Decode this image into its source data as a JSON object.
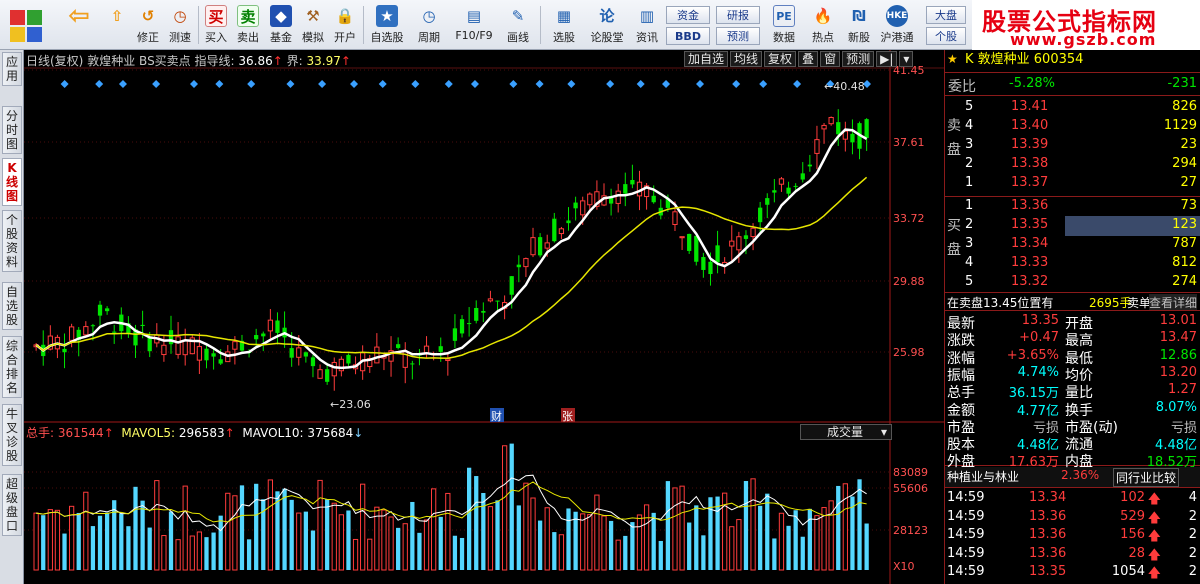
{
  "toolbar": {
    "buttons": [
      "修正",
      "测速",
      "买入",
      "卖出",
      "基金",
      "模拟",
      "开户",
      "自选股",
      "周期",
      "F10/F9",
      "画线",
      "选股",
      "论股堂",
      "资讯",
      "数据",
      "热点",
      "新股",
      "沪港通"
    ],
    "small": {
      "zijin": "资金",
      "bbd": "BBD",
      "yanbao": "研报",
      "yuce": "预测",
      "dapan": "大盘",
      "gegu": "个股"
    }
  },
  "brand": {
    "title": "股票公式指标网",
    "url": "www.gszb.com"
  },
  "side_tabs": [
    "应用",
    "分时图",
    "K线图",
    "个股资料",
    "自选股",
    "综合排名",
    "牛叉诊股",
    "超级盘口"
  ],
  "chart": {
    "header": {
      "period": "日线(复权)",
      "stock": "敦煌种业",
      "indicator": "BS买卖点",
      "guide_label": "指导线:",
      "guide_value": "36.86",
      "bound_label": "界:",
      "bound_value": "33.97"
    },
    "buttons": [
      "加自选",
      "均线",
      "复权",
      "叠",
      "窗",
      "预测"
    ],
    "price_axis": [
      "41.45",
      "37.61",
      "33.72",
      "29.88",
      "25.98"
    ],
    "annotations": {
      "high": "40.48",
      "low": "23.06"
    },
    "markers": {
      "cai": "财",
      "zhang": "张"
    },
    "volume_header": {
      "total_label": "总手:",
      "total_value": "361544",
      "ma5_label": "MAVOL5:",
      "ma5_value": "296583",
      "ma10_label": "MAVOL10:",
      "ma10_value": "375684"
    },
    "volume_select": "成交量",
    "volume_axis": [
      "83089",
      "55606",
      "28123",
      "X10"
    ],
    "colors": {
      "up": "#ff3c3c",
      "down": "#00e600",
      "ma_white": "#ffffff",
      "ma_yellow": "#e6e600",
      "vol_up": "#ff3c3c",
      "vol_down": "#54d7ff"
    }
  },
  "panel": {
    "title": "K 敦煌种业 600354",
    "weibi_label": "委比",
    "weibi_pct": "-5.28%",
    "weibi_val": "-231",
    "sell_label": "卖盘",
    "buy_label": "买盘",
    "sell": [
      {
        "lvl": "5",
        "price": "13.41",
        "vol": "826"
      },
      {
        "lvl": "4",
        "price": "13.40",
        "vol": "1129"
      },
      {
        "lvl": "3",
        "price": "13.39",
        "vol": "23"
      },
      {
        "lvl": "2",
        "price": "13.38",
        "vol": "294"
      },
      {
        "lvl": "1",
        "price": "13.37",
        "vol": "27"
      }
    ],
    "buy": [
      {
        "lvl": "1",
        "price": "13.36",
        "vol": "73"
      },
      {
        "lvl": "2",
        "price": "13.35",
        "vol": "123"
      },
      {
        "lvl": "3",
        "price": "13.34",
        "vol": "787"
      },
      {
        "lvl": "4",
        "price": "13.33",
        "vol": "812"
      },
      {
        "lvl": "5",
        "price": "13.32",
        "vol": "274"
      }
    ],
    "notice": {
      "left": "在卖盘13.45位置有",
      "qty": "2695手",
      "right": "卖单!",
      "link": "查看详细"
    },
    "stats": [
      {
        "l1": "最新",
        "v1": "13.35",
        "c1": "red",
        "l2": "开盘",
        "v2": "13.01",
        "c2": "red"
      },
      {
        "l1": "涨跌",
        "v1": "+0.47",
        "c1": "red",
        "l2": "最高",
        "v2": "13.47",
        "c2": "red"
      },
      {
        "l1": "涨幅",
        "v1": "+3.65%",
        "c1": "red",
        "l2": "最低",
        "v2": "12.86",
        "c2": "green"
      },
      {
        "l1": "振幅",
        "v1": "4.74%",
        "c1": "cyan",
        "l2": "均价",
        "v2": "13.20",
        "c2": "red"
      },
      {
        "l1": "总手",
        "v1": "36.15万",
        "c1": "cyan",
        "l2": "量比",
        "v2": "1.27",
        "c2": "red"
      },
      {
        "l1": "金额",
        "v1": "4.77亿",
        "c1": "cyan",
        "l2": "换手",
        "v2": "8.07%",
        "c2": "cyan"
      },
      {
        "l1": "市盈",
        "v1": "亏损",
        "c1": "gray",
        "l2": "市盈(动)",
        "v2": "亏损",
        "c2": "gray"
      },
      {
        "l1": "股本",
        "v1": "4.48亿",
        "c1": "cyan",
        "l2": "流通",
        "v2": "4.48亿",
        "c2": "cyan"
      },
      {
        "l1": "外盘",
        "v1": "17.63万",
        "c1": "red",
        "l2": "内盘",
        "v2": "18.52万",
        "c2": "green"
      }
    ],
    "industry": {
      "name": "种植业与林业",
      "pct": "2.36%",
      "compare": "同行业比较"
    },
    "ticks": [
      {
        "time": "14:59",
        "price": "13.34",
        "vol": "102",
        "dir": "up",
        "n": "4"
      },
      {
        "time": "14:59",
        "price": "13.36",
        "vol": "529",
        "dir": "up",
        "n": "2"
      },
      {
        "time": "14:59",
        "price": "13.36",
        "vol": "156",
        "dir": "up",
        "n": "2"
      },
      {
        "time": "14:59",
        "price": "13.36",
        "vol": "28",
        "dir": "up",
        "n": "2"
      },
      {
        "time": "14:59",
        "price": "13.35",
        "vol": "1054",
        "dir": "up",
        "n": "2"
      }
    ]
  }
}
